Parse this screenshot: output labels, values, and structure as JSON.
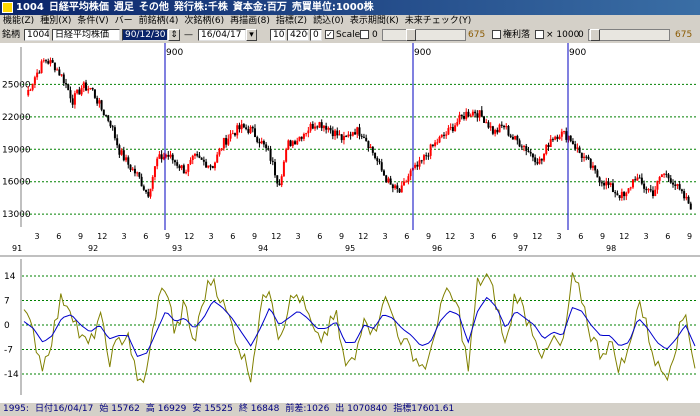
{
  "window": {
    "title": [
      "1004",
      "日経平均株価",
      "週足",
      "その他",
      "発行株:千株",
      "資本金:百万",
      "売買単位:1000株"
    ]
  },
  "menu": [
    "機能(Z)",
    "種別(X)",
    "条件(V)",
    "バー",
    "前銘柄(4)",
    "次銘柄(6)",
    "再描画(8)",
    "指標(Z)",
    "読込(0)",
    "表示期間(K)",
    "未来チェック(Y)"
  ],
  "toolbar": {
    "symbol_label": "銘柄",
    "code": "1004",
    "name": "日経平均株価",
    "date_from": "90/12/30",
    "dash": "—",
    "date_to": "16/04/17",
    "param1": "10",
    "param2": "4200",
    "param3": "0",
    "check1": "✓",
    "scale_label": "Scale",
    "scale_value": "0",
    "slider1_value": "675",
    "kenri_label": "権利落",
    "mult_label": "× 1000",
    "mult_value": "0",
    "slider2_value": "675"
  },
  "colors": {
    "up": "#ff0000",
    "down": "#000000",
    "grid": "#008000",
    "cursor": "#0000c0",
    "osc1": "#808000",
    "osc2": "#0000cc"
  },
  "icons": {
    "spin": "spin-icon",
    "dropdown": "chevron-down-icon",
    "check": "checkbox"
  },
  "status": {
    "id": "1995:",
    "date": "日付16/04/17",
    "open": "始 15762",
    "high": "高 16929",
    "low": "安 15525",
    "close": "終 16848",
    "change": "前差:1026",
    "volume": "出 1070840",
    "index": "指標17601.61"
  },
  "chart_data": [
    {
      "type": "candlestick",
      "yticks": [
        "25000",
        "22000",
        "19000",
        "16000",
        "13000"
      ],
      "ylim": [
        12000,
        27900
      ],
      "marker_label": "900",
      "x_month_ticks": [
        "3",
        "6",
        "9",
        "12",
        "3",
        "6",
        "9",
        "12",
        "3",
        "6",
        "9",
        "12",
        "3",
        "6",
        "9",
        "12",
        "3",
        "6",
        "9",
        "12",
        "3",
        "6",
        "9",
        "12",
        "3",
        "6",
        "9",
        "12",
        "3",
        "6",
        "9"
      ],
      "x_year_labels": [
        "91",
        "92",
        "93",
        "94",
        "95",
        "96",
        "97",
        "98"
      ],
      "series_close": [
        24000,
        25800,
        27300,
        26800,
        25500,
        23500,
        24800,
        24600,
        22800,
        21500,
        18800,
        17500,
        16500,
        14800,
        18000,
        18500,
        17800,
        17000,
        18200,
        17800,
        17500,
        19500,
        20500,
        21000,
        20800,
        19800,
        18500,
        15800,
        19500,
        20000,
        20800,
        21500,
        21200,
        20500,
        19800,
        20800,
        20500,
        18800,
        17000,
        15500,
        15000,
        16800,
        17500,
        18800,
        19800,
        20500,
        21500,
        22300,
        22500,
        21800,
        20500,
        21200,
        20000,
        19500,
        18500,
        17800,
        20000,
        20500,
        20200,
        18800,
        17800,
        16500,
        15800,
        15000,
        14500,
        16500,
        15500,
        15000,
        16800,
        16200,
        14800,
        13800
      ]
    },
    {
      "type": "line",
      "yticks": [
        "14",
        "7",
        "0",
        "-7",
        "-14"
      ],
      "ylim": [
        -20,
        16
      ],
      "series": [
        {
          "values": [
            4,
            -3,
            -12,
            -3,
            8,
            5,
            -4,
            -6,
            3,
            -10,
            -5,
            -2,
            -17,
            -14,
            5,
            12,
            -3,
            6,
            -6,
            8,
            14,
            6,
            0,
            -8,
            -14,
            4,
            12,
            -4,
            6,
            9,
            3,
            -5,
            -2,
            3,
            -12,
            -10,
            4,
            -3,
            8,
            3,
            -5,
            -7,
            -12,
            -10,
            6,
            9,
            4,
            -13,
            12,
            14,
            6,
            -7,
            10,
            3,
            -2,
            -10,
            -4,
            -7,
            13,
            8,
            -3,
            -8,
            -5,
            -12,
            -8,
            8,
            -2,
            -12,
            -14,
            -5,
            4,
            -12
          ]
        },
        {
          "values": [
            1,
            -1,
            -5,
            -3,
            2,
            3,
            0,
            -2,
            0,
            -4,
            -3,
            -3,
            -9,
            -8,
            -2,
            4,
            1,
            2,
            -1,
            2,
            7,
            5,
            2,
            -2,
            -6,
            -1,
            5,
            0,
            2,
            4,
            2,
            -1,
            -1,
            1,
            -5,
            -5,
            0,
            -1,
            3,
            2,
            -1,
            -3,
            -6,
            -5,
            1,
            4,
            3,
            -5,
            4,
            8,
            5,
            -1,
            4,
            2,
            0,
            -4,
            -2,
            -3,
            5,
            4,
            0,
            -3,
            -3,
            -6,
            -5,
            2,
            -1,
            -5,
            -7,
            -4,
            0,
            -6
          ]
        }
      ]
    }
  ]
}
